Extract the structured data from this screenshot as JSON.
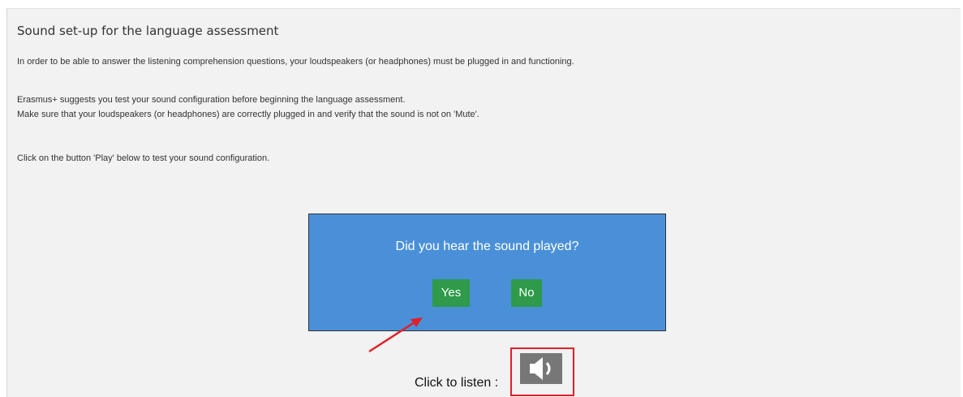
{
  "page": {
    "title": "Sound set-up for the language assessment",
    "paragraph_1": "In order to be able to answer the listening comprehension questions, your loudspeakers (or headphones) must be plugged in and functioning.",
    "paragraph_2": "Erasmus+ suggests you test your sound configuration before beginning the language assessment.",
    "paragraph_3": "Make sure that your loudspeakers (or headphones) are correctly plugged in and verify that the sound is not on 'Mute'.",
    "paragraph_4": "Click on the button 'Play' below to test your sound configuration."
  },
  "dialog": {
    "question": "Did you hear the sound played?",
    "yes_label": "Yes",
    "no_label": "No",
    "background_color": "#4a90d9",
    "button_color": "#2e9a4a"
  },
  "listen": {
    "label": "Click to listen :",
    "icon": "speaker-icon"
  },
  "annotations": {
    "highlight_color": "#e0202a"
  }
}
